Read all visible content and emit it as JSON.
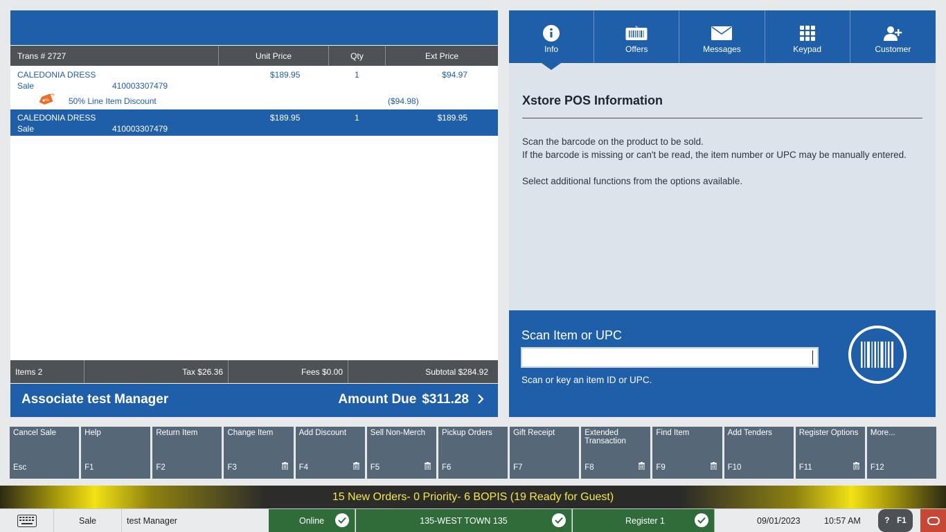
{
  "transaction": {
    "columns": {
      "trans": "Trans #  2727",
      "unit_price": "Unit Price",
      "qty": "Qty",
      "ext_price": "Ext Price"
    },
    "lines": [
      {
        "name": "CALEDONIA DRESS",
        "type": "Sale",
        "sku": "410003307479",
        "unit_price": "$189.95",
        "qty": "1",
        "ext_price": "$94.97",
        "discount": {
          "label": "50% Line Item Discount",
          "amount": "($94.98)"
        }
      },
      {
        "name": "CALEDONIA DRESS",
        "type": "Sale",
        "sku": "410003307479",
        "unit_price": "$189.95",
        "qty": "1",
        "ext_price": "$189.95"
      }
    ],
    "totals": {
      "items": "Items 2",
      "tax": "Tax $26.36",
      "fees": "Fees $0.00",
      "subtotal": "Subtotal $284.92"
    },
    "associate": "Associate test Manager",
    "amount_due_label": "Amount Due",
    "amount_due": "$311.28"
  },
  "tabs": [
    {
      "label": "Info",
      "icon": "info-icon",
      "active": true
    },
    {
      "label": "Offers",
      "icon": "offers-barcode-icon",
      "active": false
    },
    {
      "label": "Messages",
      "icon": "envelope-icon",
      "active": false
    },
    {
      "label": "Keypad",
      "icon": "keypad-icon",
      "active": false
    },
    {
      "label": "Customer",
      "icon": "add-customer-icon",
      "active": false
    }
  ],
  "info": {
    "title": "Xstore POS Information",
    "line1": "Scan the barcode on the product to be sold.",
    "line2": "If the barcode is missing or can't be read, the item number or UPC may be manually entered.",
    "line3": "Select additional functions from the options available."
  },
  "scan": {
    "label": "Scan Item or UPC",
    "value": "",
    "hint": "Scan or key an item ID or UPC."
  },
  "fkeys": [
    {
      "label": "Cancel Sale",
      "key": "Esc",
      "trash": false
    },
    {
      "label": "Help",
      "key": "F1",
      "trash": false
    },
    {
      "label": "Return Item",
      "key": "F2",
      "trash": false
    },
    {
      "label": "Change Item",
      "key": "F3",
      "trash": true
    },
    {
      "label": "Add Discount",
      "key": "F4",
      "trash": true
    },
    {
      "label": "Sell Non-Merch",
      "key": "F5",
      "trash": true
    },
    {
      "label": "Pickup Orders",
      "key": "F6",
      "trash": false
    },
    {
      "label": "Gift Receipt",
      "key": "F7",
      "trash": false
    },
    {
      "label": "Extended Transaction",
      "key": "F8",
      "trash": true
    },
    {
      "label": "Find Item",
      "key": "F9",
      "trash": true
    },
    {
      "label": "Add Tenders",
      "key": "F10",
      "trash": false
    },
    {
      "label": "Register Options",
      "key": "F11",
      "trash": true
    },
    {
      "label": "More...",
      "key": "F12",
      "trash": false
    }
  ],
  "banner": "15 New Orders- 0 Priority- 6 BOPIS (19 Ready for Guest)",
  "status": {
    "mode": "Sale",
    "user": "test Manager",
    "online": "Online",
    "store": "135-WEST TOWN 135",
    "register": "Register 1",
    "date": "09/01/2023",
    "time": "10:57 AM",
    "help": "?",
    "help_key": "F1"
  },
  "colors": {
    "primary_blue": "#1f5ea8",
    "header_gray": "#4e5257",
    "fkey_slate": "#566778",
    "status_green": "#2f6c3a",
    "oracle_red": "#c74634",
    "banner_yellow": "#f5e64a"
  }
}
